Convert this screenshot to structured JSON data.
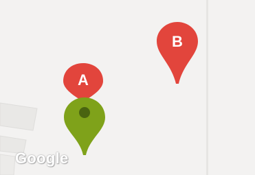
{
  "map": {
    "background_color": "#f3f2f1",
    "markers": [
      {
        "label": "A",
        "color": "#e2453c",
        "icon": "map-pin-icon"
      },
      {
        "label": "B",
        "color": "#e2453c",
        "icon": "map-pin-icon"
      },
      {
        "label": "",
        "color": "#7fa21a",
        "icon": "map-pin-icon"
      }
    ],
    "attribution": "Google"
  }
}
